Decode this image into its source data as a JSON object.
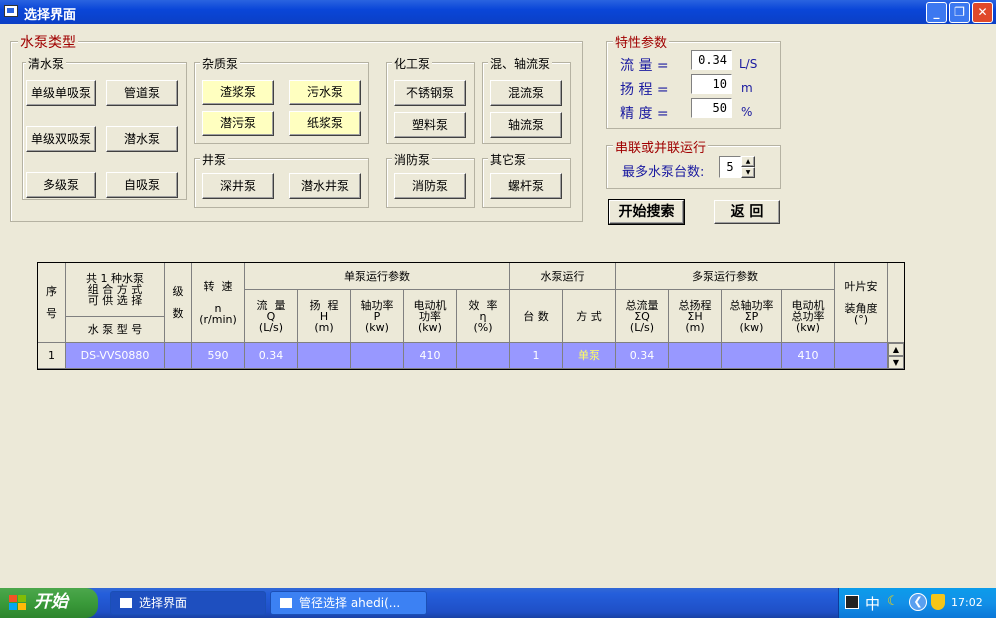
{
  "window": {
    "title": "选择界面"
  },
  "groups": {
    "pump_type": "水泵类型",
    "clean": "清水泵",
    "impurity": "杂质泵",
    "chemical": "化工泵",
    "mixed": "混、轴流泵",
    "well": "井泵",
    "fire": "消防泵",
    "other": "其它泵",
    "params": "特性参数",
    "series": "串联或并联运行"
  },
  "buttons": {
    "single_stage_single_suction": "单级单吸泵",
    "pipeline": "管道泵",
    "single_stage_double_suction": "单级双吸泵",
    "submersible": "潜水泵",
    "multistage": "多级泵",
    "self_priming": "自吸泵",
    "slurry": "渣浆泵",
    "sewage": "污水泵",
    "submersible_sewage": "潜污泵",
    "paper_pulp": "纸浆泵",
    "stainless": "不锈钢泵",
    "plastic": "塑料泵",
    "mixed_flow": "混流泵",
    "axial_flow": "轴流泵",
    "deep_well": "深井泵",
    "submersible_well": "潜水井泵",
    "fire_pump": "消防泵",
    "screw": "螺杆泵",
    "start_search": "开始搜索",
    "back": "返 回"
  },
  "params": {
    "flow_label": "流  量 =",
    "flow_value": "0.34",
    "flow_unit": "L/S",
    "head_label": "扬  程 =",
    "head_value": "10",
    "head_unit": "m",
    "precision_label": "精  度 =",
    "precision_value": "50",
    "precision_unit": "%"
  },
  "series": {
    "max_pumps_label": "最多水泵台数:",
    "max_pumps_value": "5"
  },
  "table": {
    "h_seq": "序\n\n号",
    "h_pump": "共 1 种水泵\n组 合 方 式\n可 供 选 择",
    "h_model": "水 泵 型 号",
    "h_stage": "级\n\n数",
    "h_speed": "转  速\n\nn\n(r/min)",
    "h_single": "单泵运行参数",
    "h_run": "水泵运行",
    "h_multi": "多泵运行参数",
    "h_blade": "叶片安\n\n装角度\n(°)",
    "h_flow": "流  量\nQ\n(L/s)",
    "h_head": "扬  程\nH\n(m)",
    "h_shaft": "轴功率\nP\n(kw)",
    "h_motor": "电动机\n功率\n(kw)",
    "h_eff": "效  率\nη\n(%)",
    "h_count": "台  数",
    "h_mode": "方  式",
    "h_tflow": "总流量\nΣQ\n(L/s)",
    "h_thead": "总扬程\nΣH\n(m)",
    "h_tshaft": "总轴功率\nΣP\n(kw)",
    "h_tmotor": "电动机\n总功率\n(kw)",
    "row": {
      "seq": "1",
      "model": "DS-VVS0880",
      "stage": "",
      "speed": "590",
      "flow": "0.34",
      "head": "",
      "shaft": "",
      "motor": "410",
      "eff": "",
      "count": "1",
      "mode": "单泵",
      "tflow": "0.34",
      "thead": "",
      "tshaft": "",
      "tmotor": "410",
      "blade": ""
    }
  },
  "taskbar": {
    "start": "开始",
    "task1": "选择界面",
    "task2": "管径选择  ahedi(...",
    "ime": "中",
    "time": "17:02"
  }
}
